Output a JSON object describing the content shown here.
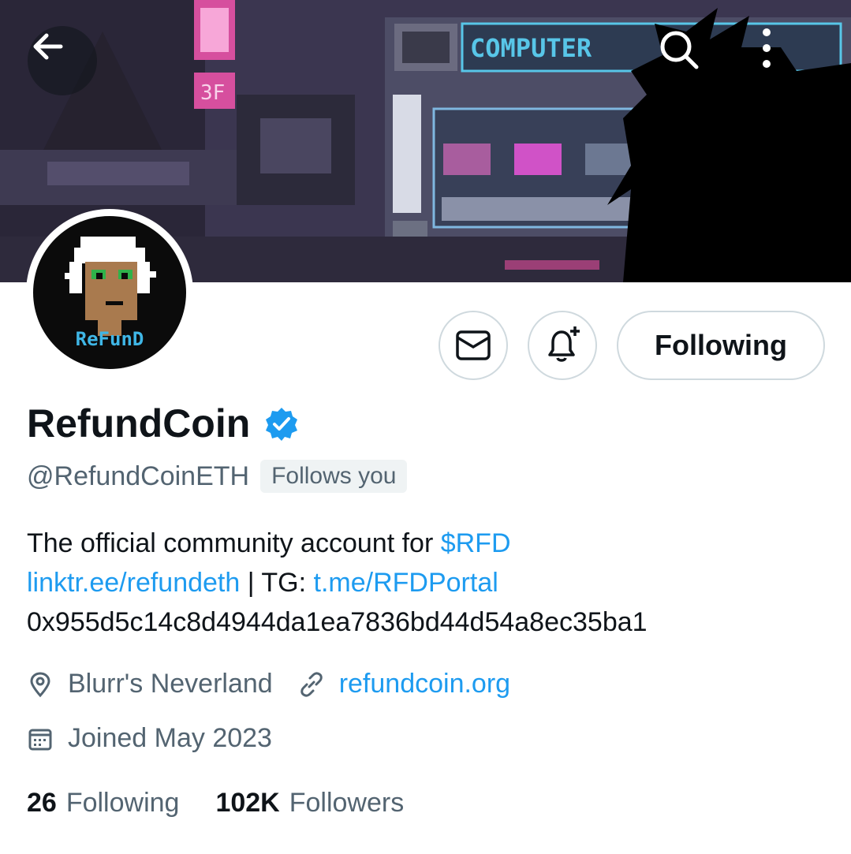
{
  "header": {
    "back_icon": "back-arrow-icon",
    "search_icon": "search-icon",
    "more_icon": "more-vertical-icon",
    "banner_sign": "COMPUTER",
    "banner_floor": "3F"
  },
  "profile": {
    "avatar_label": "ReFunD",
    "name": "RefundCoin",
    "verified": true,
    "handle": "@RefundCoinETH",
    "follows_you": "Follows you",
    "bio": {
      "line1_text": "The official community account for ",
      "line1_link": "$RFD",
      "line2_link1": "linktr.ee/refundeth",
      "line2_sep": " | TG: ",
      "line2_link2": "t.me/RFDPortal",
      "line3_text": "0x955d5c14c8d4944da1ea7836bd44d54a8ec35ba1"
    },
    "location": "Blurr's Neverland",
    "website": "refundcoin.org",
    "joined": "Joined May 2023",
    "following_count": "26",
    "following_label": "Following",
    "followers_count": "102K",
    "followers_label": "Followers"
  },
  "actions": {
    "message_icon": "envelope-icon",
    "notify_icon": "bell-plus-icon",
    "follow_state_label": "Following"
  },
  "colors": {
    "link": "#1d9bf0",
    "secondary_text": "#536471",
    "primary_text": "#0f1419",
    "verified": "#1d9bf0",
    "avatar_text": "#3fb6e6"
  }
}
